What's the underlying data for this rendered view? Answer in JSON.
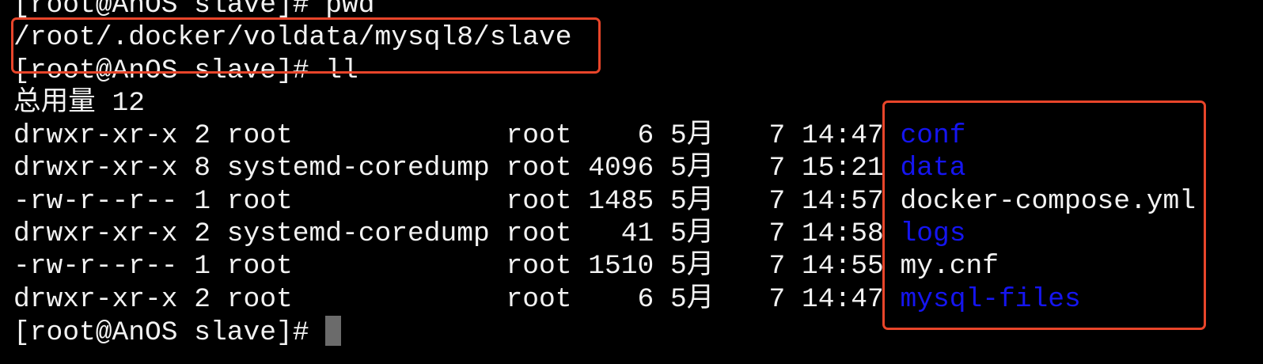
{
  "lines": {
    "cmd_pwd": "[root@AnOS slave]# pwd",
    "pwd_output": "/root/.docker/voldata/mysql8/slave",
    "cmd_ll": "[root@AnOS slave]# ll",
    "total": "总用量 12",
    "prompt": "[root@AnOS slave]# "
  },
  "listing": [
    {
      "prefix": "drwxr-xr-x 2 root             root    6 ",
      "month_num": "5",
      "month_cjk": "月",
      "date_time": "   7 14:47 ",
      "name": "conf",
      "is_dir": true
    },
    {
      "prefix": "drwxr-xr-x 8 systemd-coredump root 4096 ",
      "month_num": "5",
      "month_cjk": "月",
      "date_time": "   7 15:21 ",
      "name": "data",
      "is_dir": true
    },
    {
      "prefix": "-rw-r--r-- 1 root             root 1485 ",
      "month_num": "5",
      "month_cjk": "月",
      "date_time": "   7 14:57 ",
      "name": "docker-compose.yml",
      "is_dir": false
    },
    {
      "prefix": "drwxr-xr-x 2 systemd-coredump root   41 ",
      "month_num": "5",
      "month_cjk": "月",
      "date_time": "   7 14:58 ",
      "name": "logs",
      "is_dir": true
    },
    {
      "prefix": "-rw-r--r-- 1 root             root 1510 ",
      "month_num": "5",
      "month_cjk": "月",
      "date_time": "   7 14:55 ",
      "name": "my.cnf",
      "is_dir": false
    },
    {
      "prefix": "drwxr-xr-x 2 root             root    6 ",
      "month_num": "5",
      "month_cjk": "月",
      "date_time": "   7 14:47 ",
      "name": "mysql-files",
      "is_dir": true
    }
  ],
  "colors": {
    "directory": "#1515f0",
    "highlight_box": "#e8452a",
    "text": "#f2f2f2",
    "background": "#000000"
  }
}
